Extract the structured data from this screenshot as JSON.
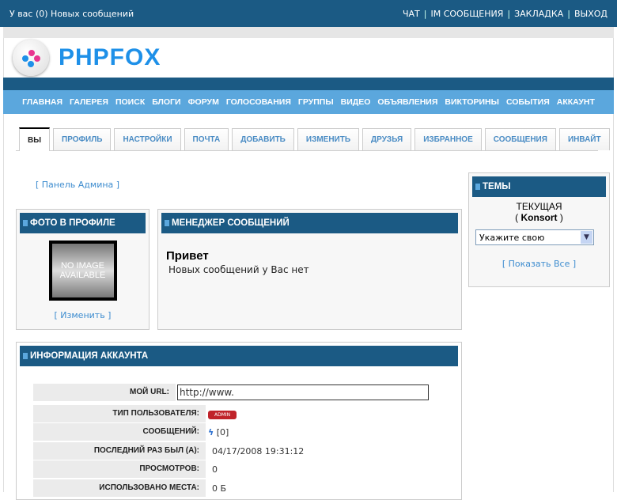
{
  "topbar": {
    "new_messages": "У вас (0) Новых сообщений",
    "links": [
      "ЧАТ",
      "IM СООБЩЕНИЯ",
      "ЗАКЛАДКА",
      "ВЫХОД"
    ]
  },
  "logo": {
    "text": "PHPFOX"
  },
  "nav": [
    "ГЛАВНАЯ",
    "ГАЛЕРЕЯ",
    "ПОИСК",
    "БЛОГИ",
    "ФОРУМ",
    "ГОЛОСОВАНИЯ",
    "ГРУППЫ",
    "ВИДЕО",
    "ОБЪЯВЛЕНИЯ",
    "ВИКТОРИНЫ",
    "СОБЫТИЯ",
    "АККАУНТ"
  ],
  "tabs": [
    "ВЫ",
    "ПРОФИЛЬ",
    "НАСТРОЙКИ",
    "ПОЧТА",
    "ДОБАВИТЬ",
    "ИЗМЕНИТЬ",
    "ДРУЗЬЯ",
    "ИЗБРАННОЕ",
    "СООБЩЕНИЯ",
    "ИНВАЙТ"
  ],
  "admin_panel": "[ Панель Админа ]",
  "photo": {
    "title": "ФОТО В ПРОФИЛЕ",
    "no_image": "NO IMAGE AVAILABLE",
    "change": "[ Изменить ]"
  },
  "messages": {
    "title": "МЕНЕДЖЕР СООБЩЕНИЙ",
    "greeting": "Привет",
    "none": "Новых сообщений у Вас нет"
  },
  "themes": {
    "title": "ТЕМЫ",
    "current_label": "ТЕКУЩАЯ",
    "current_open": "( ",
    "current": "Konsort",
    "current_close": " )",
    "select": "Укажите свою",
    "show_all": "[ Показать Все ]"
  },
  "account": {
    "title": "ИНФОРМАЦИЯ АККАУНТА",
    "rows": [
      {
        "label": "МОЙ URL:",
        "value": "http://www."
      },
      {
        "label": "ТИП ПОЛЬЗОВАТЕЛЯ:",
        "value": "ADMIN"
      },
      {
        "label": "СООБЩЕНИЙ:",
        "value": "[0]"
      },
      {
        "label": "ПОСЛЕДНИЙ РАЗ БЫЛ (А):",
        "value": "04/17/2008 19:31:12"
      },
      {
        "label": "ПРОСМОТРОВ:",
        "value": "0"
      },
      {
        "label": "ИСПОЛЬЗОВАНО МЕСТА:",
        "value": "0 Б"
      }
    ]
  },
  "colors": {
    "dark": "#1b5a84",
    "nav": "#5ba7dd",
    "link": "#3d8ccf"
  }
}
